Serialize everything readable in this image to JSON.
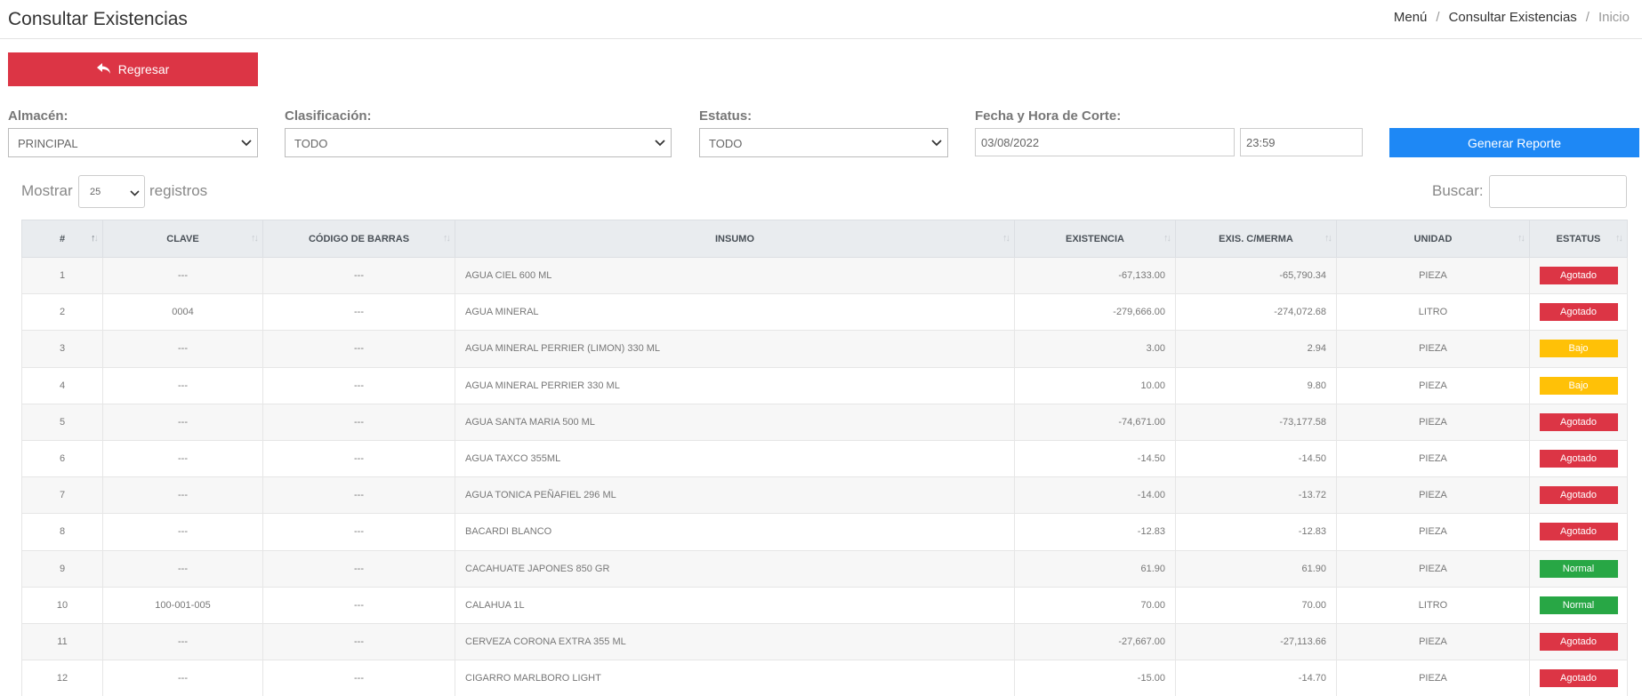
{
  "header": {
    "title": "Consultar Existencias",
    "breadcrumb": [
      "Menú",
      "Consultar Existencias",
      "Inicio"
    ]
  },
  "back_button": {
    "label": "Regresar",
    "icon": "reply-icon"
  },
  "filters": {
    "almacen": {
      "label": "Almacén:",
      "value": "PRINCIPAL"
    },
    "clasificacion": {
      "label": "Clasificación:",
      "value": "TODO"
    },
    "estatus": {
      "label": "Estatus:",
      "value": "TODO"
    },
    "corte": {
      "label": "Fecha y Hora de Corte:",
      "date": "03/08/2022",
      "time": "23:59"
    },
    "generate_label": "Generar Reporte"
  },
  "table_controls": {
    "show_label": "Mostrar",
    "page_length": "25",
    "records_label": "registros",
    "search_label": "Buscar:"
  },
  "columns": [
    "#",
    "CLAVE",
    "CÓDIGO DE BARRAS",
    "INSUMO",
    "EXISTENCIA",
    "EXIS. C/MERMA",
    "UNIDAD",
    "ESTATUS"
  ],
  "rows": [
    {
      "n": "1",
      "clave": "---",
      "codigo": "---",
      "insumo": "AGUA CIEL 600 ML",
      "existencia": "-67,133.00",
      "merma": "-65,790.34",
      "unidad": "PIEZA",
      "estatus": "Agotado"
    },
    {
      "n": "2",
      "clave": "0004",
      "codigo": "---",
      "insumo": "AGUA MINERAL",
      "existencia": "-279,666.00",
      "merma": "-274,072.68",
      "unidad": "LITRO",
      "estatus": "Agotado"
    },
    {
      "n": "3",
      "clave": "---",
      "codigo": "---",
      "insumo": "AGUA MINERAL PERRIER (LIMON) 330 ML",
      "existencia": "3.00",
      "merma": "2.94",
      "unidad": "PIEZA",
      "estatus": "Bajo"
    },
    {
      "n": "4",
      "clave": "---",
      "codigo": "---",
      "insumo": "AGUA MINERAL PERRIER 330 ML",
      "existencia": "10.00",
      "merma": "9.80",
      "unidad": "PIEZA",
      "estatus": "Bajo"
    },
    {
      "n": "5",
      "clave": "---",
      "codigo": "---",
      "insumo": "AGUA SANTA MARIA 500 ML",
      "existencia": "-74,671.00",
      "merma": "-73,177.58",
      "unidad": "PIEZA",
      "estatus": "Agotado"
    },
    {
      "n": "6",
      "clave": "---",
      "codigo": "---",
      "insumo": "AGUA TAXCO 355ML",
      "existencia": "-14.50",
      "merma": "-14.50",
      "unidad": "PIEZA",
      "estatus": "Agotado"
    },
    {
      "n": "7",
      "clave": "---",
      "codigo": "---",
      "insumo": "AGUA TONICA PEÑAFIEL 296 ML",
      "existencia": "-14.00",
      "merma": "-13.72",
      "unidad": "PIEZA",
      "estatus": "Agotado"
    },
    {
      "n": "8",
      "clave": "---",
      "codigo": "---",
      "insumo": "BACARDI BLANCO",
      "existencia": "-12.83",
      "merma": "-12.83",
      "unidad": "PIEZA",
      "estatus": "Agotado"
    },
    {
      "n": "9",
      "clave": "---",
      "codigo": "---",
      "insumo": "CACAHUATE JAPONES 850 GR",
      "existencia": "61.90",
      "merma": "61.90",
      "unidad": "PIEZA",
      "estatus": "Normal"
    },
    {
      "n": "10",
      "clave": "100-001-005",
      "codigo": "---",
      "insumo": "CALAHUA 1L",
      "existencia": "70.00",
      "merma": "70.00",
      "unidad": "LITRO",
      "estatus": "Normal"
    },
    {
      "n": "11",
      "clave": "---",
      "codigo": "---",
      "insumo": "CERVEZA CORONA EXTRA 355 ML",
      "existencia": "-27,667.00",
      "merma": "-27,113.66",
      "unidad": "PIEZA",
      "estatus": "Agotado"
    },
    {
      "n": "12",
      "clave": "---",
      "codigo": "---",
      "insumo": "CIGARRO MARLBORO LIGHT",
      "existencia": "-15.00",
      "merma": "-14.70",
      "unidad": "PIEZA",
      "estatus": "Agotado"
    }
  ],
  "status_colors": {
    "Agotado": "#dc3545",
    "Bajo": "#ffc107",
    "Normal": "#28a745"
  }
}
